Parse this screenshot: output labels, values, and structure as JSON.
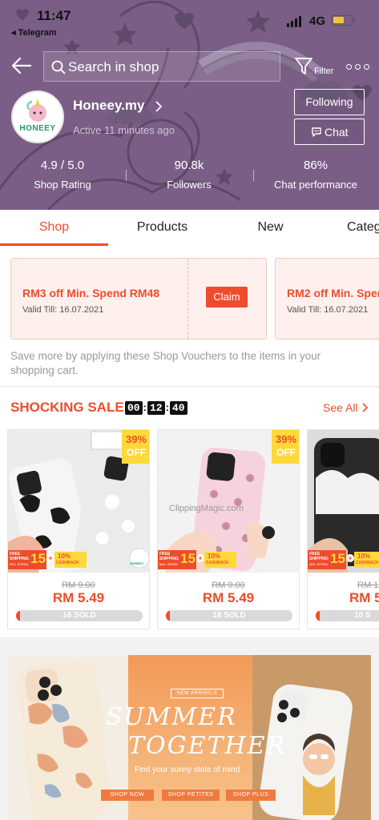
{
  "status_bar": {
    "time": "11:47",
    "back_app": "◂ Telegram",
    "network": "4G"
  },
  "header": {
    "search_placeholder": "Search in shop",
    "filter_label": "Filter",
    "shop": {
      "logo_text": "HONEEY",
      "name": "Honeey.my",
      "active_status": "Active 11 minutes ago",
      "follow_label": "Following",
      "chat_label": "Chat"
    },
    "stats": [
      {
        "value": "4.9 / 5.0",
        "label": "Shop Rating"
      },
      {
        "value": "90.8k",
        "label": "Followers"
      },
      {
        "value": "86%",
        "label": "Chat performance"
      }
    ],
    "colors": {
      "background": "#7a5e86"
    }
  },
  "tabs": [
    {
      "label": "Shop",
      "active": true
    },
    {
      "label": "Products",
      "active": false
    },
    {
      "label": "New",
      "active": false
    },
    {
      "label": "Categ",
      "active": false
    }
  ],
  "vouchers": {
    "items": [
      {
        "title": "RM3 off Min. Spend RM48",
        "valid": "Valid Till: 16.07.2021",
        "claim_label": "Claim"
      },
      {
        "title": "RM2 off Min. Sper",
        "valid": "Valid Till: 16.07.2021"
      }
    ],
    "note": "Save more by applying these Shop Vouchers to the items in your shopping cart."
  },
  "sale": {
    "title": "SHOCKING SALE",
    "timer": [
      "00",
      "12",
      "40"
    ],
    "see_all_label": "See All",
    "products": [
      {
        "discount": "39%",
        "off_label": "OFF",
        "old_price": "RM 9.00",
        "price": "RM 5.49",
        "sold": "16 SOLD",
        "sold_fraction": 0.03,
        "promo": {
          "free": "FREE SHIPPING",
          "min": "MIN. SPEND",
          "num": "15",
          "cash_pct": "10%",
          "cash": "CASHBACK"
        },
        "watermark": "HONEEY"
      },
      {
        "discount": "39%",
        "off_label": "OFF",
        "old_price": "RM 9.00",
        "price": "RM 5.49",
        "sold": "18 SOLD",
        "sold_fraction": 0.03,
        "promo": {
          "free": "FREE SHIPPING",
          "min": "MIN. SPEND",
          "num": "15",
          "cash_pct": "10%",
          "cash": "CASHBACK"
        },
        "watermark": "ClippingMagic.com"
      },
      {
        "old_price": "RM 1",
        "price": "RM 5",
        "sold": "10 S",
        "sold_fraction": 0.03,
        "promo": {
          "free": "FREE SHIPPING",
          "min": "MIN. SPEND",
          "num": "15",
          "cash_pct": "10%",
          "cash": "CASHBACK"
        }
      }
    ],
    "colors": {
      "accent": "#ee4d2d",
      "badge": "#ffd839"
    }
  },
  "banner": {
    "tag": "NEW ARRIVALS",
    "headline_1": "SUMMER",
    "headline_2": "TOGETHER",
    "sub": "Find your sunny state of mind",
    "buttons": [
      "SHOP NOW",
      "SHOP PETITES",
      "SHOP PLUS"
    ]
  }
}
